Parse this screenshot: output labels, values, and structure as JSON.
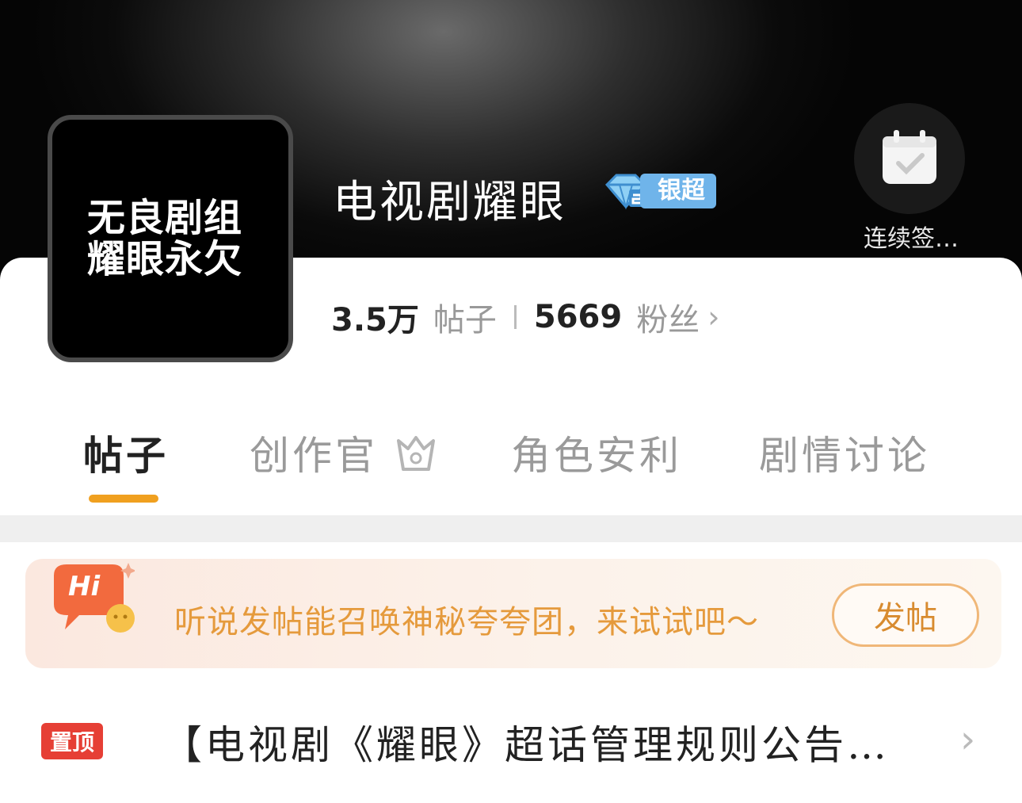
{
  "profile": {
    "avatar_text_line1": "无良剧组",
    "avatar_text_line2": "耀眼永欠",
    "title": "电视剧耀眼",
    "level_label": "银超",
    "checkin_label": "连续签…"
  },
  "stats": {
    "posts_count": "3.5万",
    "posts_label": "帖子",
    "fans_count": "5669",
    "fans_label": "粉丝"
  },
  "tabs": [
    {
      "label": "帖子",
      "active": true
    },
    {
      "label": "创作官",
      "active": false
    },
    {
      "label": "角色安利",
      "active": false
    },
    {
      "label": "剧情讨论",
      "active": false
    }
  ],
  "banner": {
    "hi_label": "Hi",
    "text": "听说发帖能召唤神秘夸夸团，来试试吧～",
    "button_label": "发帖"
  },
  "pinned": {
    "badge": "置顶",
    "title": "【电视剧《耀眼》超话管理规则公告…"
  },
  "colors": {
    "accent_orange": "#f0a01f",
    "level_blue": "#6fb4ea",
    "pin_red": "#e63f35"
  }
}
